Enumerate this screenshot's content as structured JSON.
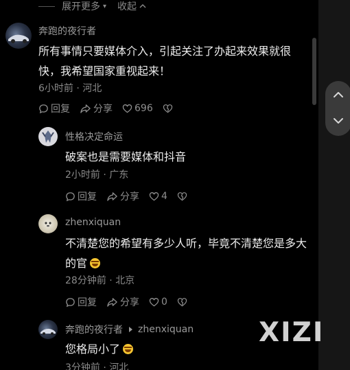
{
  "expand": {
    "more_label": "展开更多",
    "collapse_label": "收起"
  },
  "comments": [
    {
      "username": "奔跑的夜行者",
      "text": "所有事情只要媒体介入，引起关注了办起来效果就很快，我希望国家重视起来！",
      "time": "6小时前",
      "location": "河北",
      "reply_label": "回复",
      "share_label": "分享",
      "likes": "696"
    },
    {
      "username": "性格决定命运",
      "text": "破案也是需要媒体和抖音",
      "time": "2小时前",
      "location": "广东",
      "reply_label": "回复",
      "share_label": "分享",
      "likes": "4"
    },
    {
      "username": "zhenxiquan",
      "text": "不清楚您的希望有多少人听，毕竟不清楚您是多大的官",
      "time": "28分钟前",
      "location": "北京",
      "reply_label": "回复",
      "share_label": "分享",
      "likes": "0"
    },
    {
      "username": "奔跑的夜行者",
      "reply_to": "zhenxiquan",
      "text": "您格局小了",
      "time": "3分钟前",
      "location": "河北"
    }
  ],
  "meta_separator": " · ",
  "watermark": "XIZI",
  "colors": {
    "background": "#000000",
    "side_panel": "#161616",
    "nav_pill": "#3a3a3a",
    "emoji": "#f4c430"
  },
  "icons": [
    "chevron-up-icon",
    "reply-bubble-icon",
    "share-arrow-icon",
    "heart-icon",
    "dislike-heart-icon",
    "chevron-up-icon",
    "chevron-down-icon",
    "play-triangle-icon",
    "laugh-emoji-icon"
  ]
}
